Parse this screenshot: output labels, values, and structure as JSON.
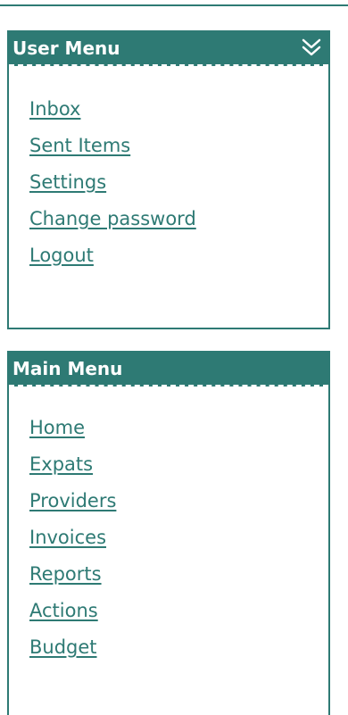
{
  "user_menu": {
    "title": "User Menu",
    "toggle_icon": "double-chevron-down-icon",
    "items": [
      {
        "label": "Inbox"
      },
      {
        "label": "Sent Items"
      },
      {
        "label": "Settings"
      },
      {
        "label": "Change password"
      },
      {
        "label": "Logout"
      }
    ]
  },
  "main_menu": {
    "title": "Main Menu",
    "items": [
      {
        "label": "Home"
      },
      {
        "label": "Expats"
      },
      {
        "label": "Providers"
      },
      {
        "label": "Invoices"
      },
      {
        "label": "Reports"
      },
      {
        "label": "Actions"
      },
      {
        "label": "Budget"
      }
    ]
  },
  "colors": {
    "accent": "#2e7a74",
    "background": "#ffffff",
    "header_text": "#ffffff"
  }
}
